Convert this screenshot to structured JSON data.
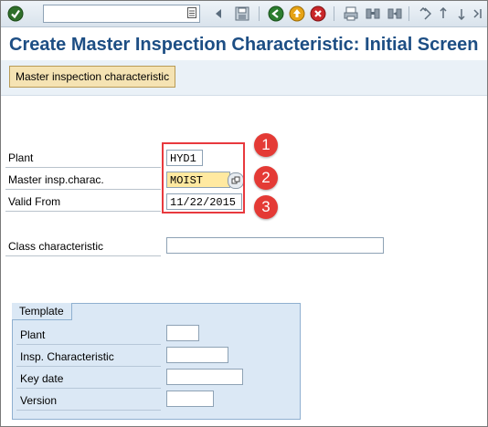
{
  "toolbar": {
    "command_field_value": "",
    "icons": [
      "enter-icon",
      "command-dropdown-icon",
      "back-arrow-icon",
      "save-icon",
      "back-icon",
      "exit-icon",
      "cancel-icon",
      "print-icon",
      "find-icon",
      "find-next-icon",
      "first-page-icon",
      "previous-page-icon",
      "next-page-icon",
      "last-page-icon"
    ]
  },
  "page": {
    "title": "Create Master Inspection Characteristic: Initial Screen",
    "app_button_label": "Master inspection characteristic"
  },
  "form": {
    "plant_label": "Plant",
    "plant_value": "HYD1",
    "mic_label": "Master insp.charac.",
    "mic_value": "MOIST",
    "valid_from_label": "Valid From",
    "valid_from_value": "11/22/2015",
    "class_char_label": "Class characteristic",
    "class_char_value": ""
  },
  "annotations": {
    "badge1": "1",
    "badge2": "2",
    "badge3": "3"
  },
  "template": {
    "title": "Template",
    "plant_label": "Plant",
    "plant_value": "",
    "insp_char_label": "Insp. Characteristic",
    "insp_char_value": "",
    "key_date_label": "Key date",
    "key_date_value": "",
    "version_label": "Version",
    "version_value": ""
  },
  "colors": {
    "title": "#1d4e84",
    "highlight_field": "#ffe9a0",
    "annotation_red": "#e43a35",
    "group_bg": "#dbe8f5"
  }
}
